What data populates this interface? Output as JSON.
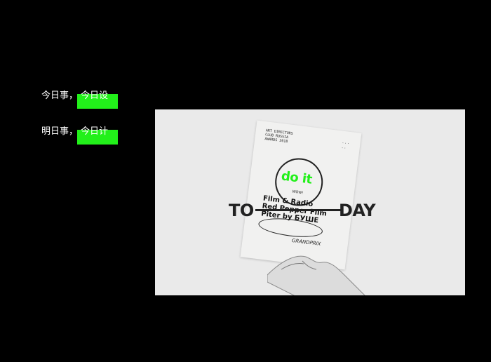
{
  "left_text": {
    "line1": {
      "label": "今日事，",
      "highlight": "今日设"
    },
    "line2": {
      "label": "明日事，",
      "highlight": "今日计"
    }
  },
  "hero": {
    "poster": {
      "small_text": "ART DIRECTORS CLUB RUSSIA AWARDS 2018",
      "headline": "do it",
      "sub": "WOW!",
      "lines": [
        "Film & Radio",
        "Red Pepper Film",
        "Piter by БУШЕ"
      ],
      "footer": "GRANDPRIX"
    },
    "title_left": "TO",
    "title_right": "DAY"
  },
  "colors": {
    "background": "#000000",
    "accent": "#22f01a",
    "panel": "#eaeaea"
  }
}
